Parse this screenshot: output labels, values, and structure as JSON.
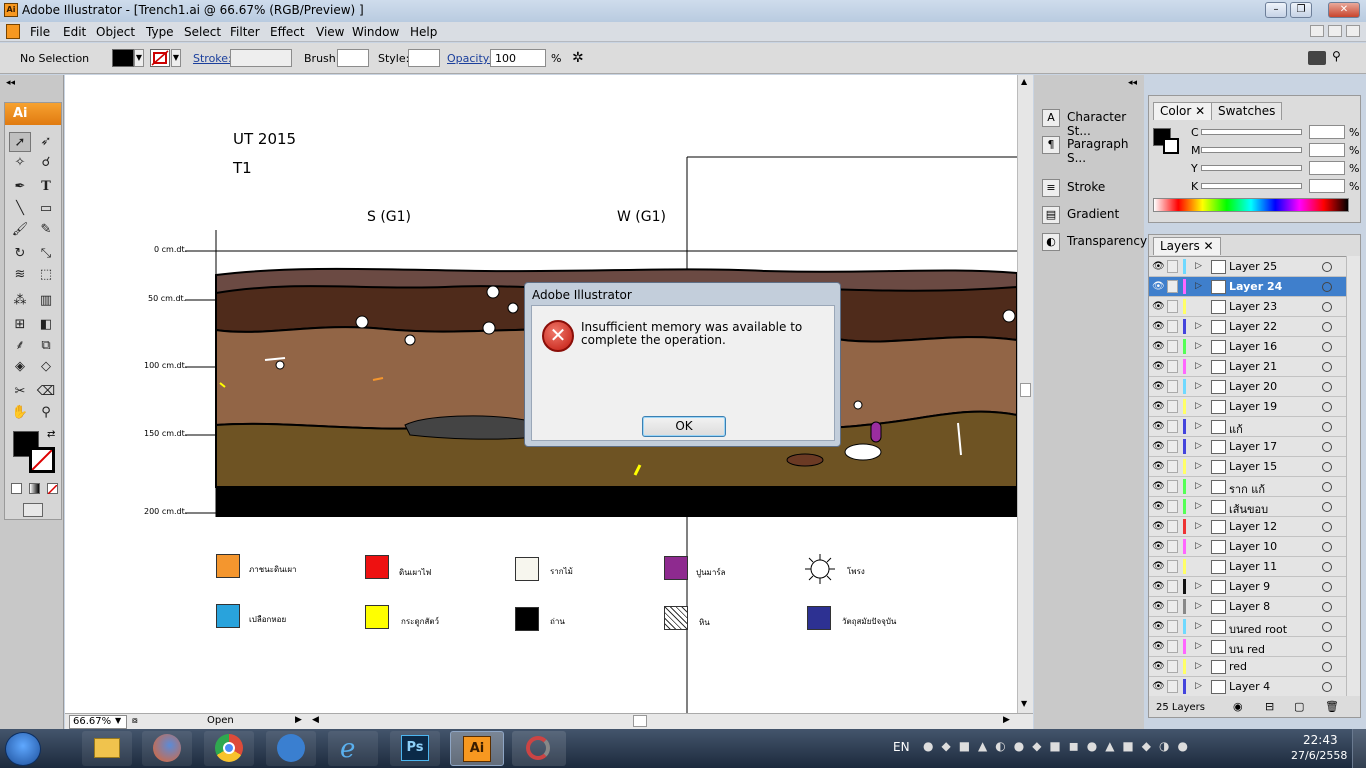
{
  "window": {
    "title": "Adobe Illustrator - [Trench1.ai @ 66.67% (RGB/Preview) ]",
    "min": "–",
    "restore": "❐",
    "close": "✕"
  },
  "menu": [
    "File",
    "Edit",
    "Object",
    "Type",
    "Select",
    "Filter",
    "Effect",
    "View",
    "Window",
    "Help"
  ],
  "control": {
    "selection": "No Selection",
    "stroke_label": "Stroke:",
    "brush_label": "Brush:",
    "style_label": "Style:",
    "opacity_label": "Opacity:",
    "opacity_value": "100",
    "opacity_unit": "%"
  },
  "tools": {
    "logo": "Ai"
  },
  "artboard": {
    "title1": "UT 2015",
    "title2": "T1",
    "section_s": "S (G1)",
    "section_w": "W (G1)",
    "depths": [
      "0 cm.dt.",
      "50 cm.dt.",
      "100 cm.dt.",
      "150 cm.dt.",
      "200 cm.dt."
    ]
  },
  "legend": [
    {
      "label": "ภาชนะดินเผา",
      "color": "#f4962e"
    },
    {
      "label": "ดินเผาไฟ",
      "color": "#ee1111"
    },
    {
      "label": "รากไม้",
      "color": "#f7f6ee"
    },
    {
      "label": "ปูนมาร์ล",
      "color": "#8e2a8f"
    },
    {
      "label": "โพรง",
      "color": "#ffffff"
    },
    {
      "label": "เปลือกหอย",
      "color": "#29a3dc"
    },
    {
      "label": "กระดูกสัตว์",
      "color": "#ffff00"
    },
    {
      "label": "ถ่าน",
      "color": "#000000"
    },
    {
      "label": "หิน",
      "color": "#ffffff"
    },
    {
      "label": "วัตถุสมัยปัจจุบัน",
      "color": "#2d3192"
    }
  ],
  "status": {
    "zoom": "66.67%",
    "state": "Open"
  },
  "dialog": {
    "title": "Adobe Illustrator",
    "message": "Insufficient memory was available to complete the operation.",
    "ok": "OK"
  },
  "panels": {
    "character": "Character St...",
    "paragraph": "Paragraph S...",
    "stroke": "Stroke",
    "gradient": "Gradient",
    "transparency": "Transparency",
    "color_tab": "Color",
    "swatches_tab": "Swatches",
    "cmyk": [
      "C",
      "M",
      "Y",
      "K"
    ],
    "pct": "%",
    "layers_tab": "Layers",
    "layers_count": "25 Layers"
  },
  "layers": [
    {
      "name": "Layer 25",
      "color": "#6fd9ff",
      "expand": true
    },
    {
      "name": "Layer 24",
      "color": "#ff66ff",
      "expand": true,
      "selected": true
    },
    {
      "name": "Layer 23",
      "color": "#ffff66",
      "expand": false
    },
    {
      "name": "Layer 22",
      "color": "#4444dd",
      "expand": true
    },
    {
      "name": "Layer 16",
      "color": "#55ff55",
      "expand": true
    },
    {
      "name": "Layer 21",
      "color": "#ff66ff",
      "expand": true
    },
    {
      "name": "Layer 20",
      "color": "#6fd9ff",
      "expand": true
    },
    {
      "name": "Layer 19",
      "color": "#ffff66",
      "expand": true
    },
    {
      "name": "แก้",
      "color": "#4444dd",
      "expand": true
    },
    {
      "name": "Layer 17",
      "color": "#4444dd",
      "expand": true
    },
    {
      "name": "Layer 15",
      "color": "#ffff66",
      "expand": true
    },
    {
      "name": "ราก แก้",
      "color": "#55ff55",
      "expand": true
    },
    {
      "name": "เส้นขอบ",
      "color": "#55ff55",
      "expand": true
    },
    {
      "name": "Layer 12",
      "color": "#ee3333",
      "expand": true
    },
    {
      "name": "Layer 10",
      "color": "#ff66ff",
      "expand": true
    },
    {
      "name": "Layer 11",
      "color": "#ffff66",
      "expand": false
    },
    {
      "name": "Layer 9",
      "color": "#111111",
      "expand": true
    },
    {
      "name": "Layer 8",
      "color": "#888888",
      "expand": true
    },
    {
      "name": "บนred root",
      "color": "#6fd9ff",
      "expand": true
    },
    {
      "name": "บน red",
      "color": "#ff66ff",
      "expand": true
    },
    {
      "name": "red",
      "color": "#ffff66",
      "expand": true
    },
    {
      "name": "Layer 4",
      "color": "#4444dd",
      "expand": true
    }
  ],
  "tray": {
    "lang": "EN",
    "time": "22:43",
    "date": "27/6/2558"
  }
}
